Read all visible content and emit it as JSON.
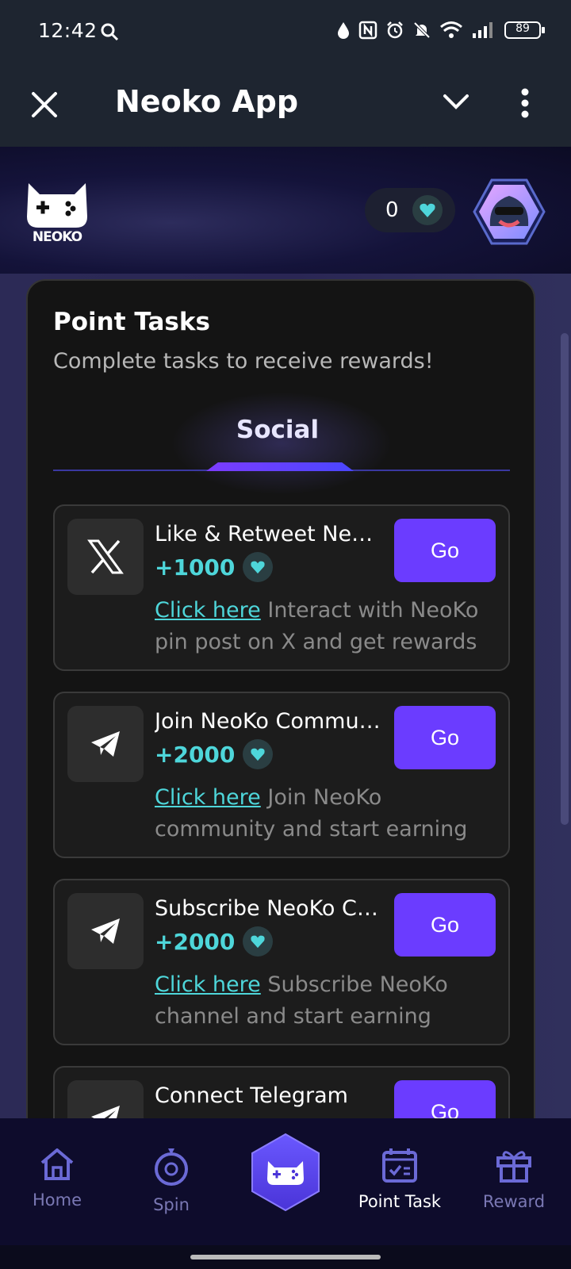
{
  "status_bar": {
    "time": "12:42",
    "battery": "89"
  },
  "app_bar": {
    "title": "Neoko App"
  },
  "header": {
    "balance": "0"
  },
  "page": {
    "title": "Point Tasks",
    "subtitle": "Complete tasks to receive rewards!",
    "active_tab": "Social"
  },
  "tasks": [
    {
      "name": "Like & Retweet NeoKo pin post",
      "points": "+1000",
      "link": "Click here",
      "desc": "Interact with NeoKo pin post on X and get rewards",
      "button": "Go",
      "icon": "x-logo-icon"
    },
    {
      "name": "Join NeoKo Community",
      "points": "+2000",
      "link": "Click here",
      "desc": "Join NeoKo community and start earning rewards",
      "button": "Go",
      "icon": "telegram-icon"
    },
    {
      "name": "Subscribe NeoKo Channel",
      "points": "+2000",
      "link": "Click here",
      "desc": "Subscribe NeoKo channel and start earning rewards",
      "button": "Go",
      "icon": "telegram-icon"
    },
    {
      "name": "Connect Telegram",
      "points": "",
      "link": "",
      "desc": "",
      "button": "Go",
      "icon": "telegram-icon"
    }
  ],
  "nav": {
    "home": "Home",
    "spin": "Spin",
    "point_task": "Point Task",
    "reward": "Reward"
  },
  "colors": {
    "accent": "#6b3cff",
    "points": "#4ed6da",
    "card_bg": "#141414"
  }
}
